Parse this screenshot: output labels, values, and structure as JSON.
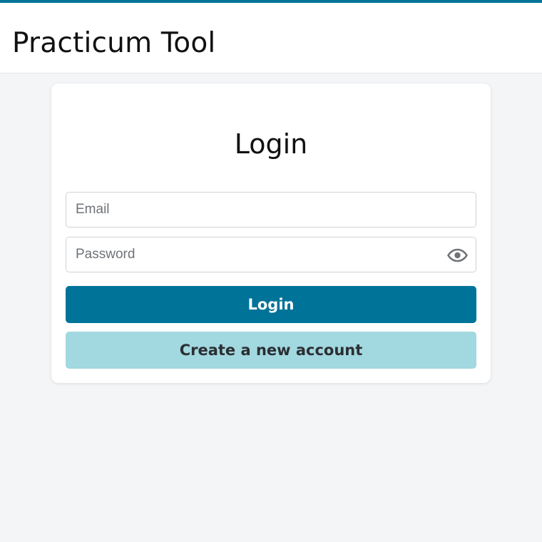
{
  "header": {
    "app_title": "Practicum Tool"
  },
  "login_card": {
    "title": "Login",
    "email": {
      "value": "",
      "placeholder": "Email"
    },
    "password": {
      "value": "",
      "placeholder": "Password",
      "toggle_icon": "eye-icon"
    },
    "login_button_label": "Login",
    "create_account_button_label": "Create a new account"
  },
  "colors": {
    "accent": "#007399",
    "secondary_button": "#a2d8e0",
    "background": "#f4f5f7"
  }
}
